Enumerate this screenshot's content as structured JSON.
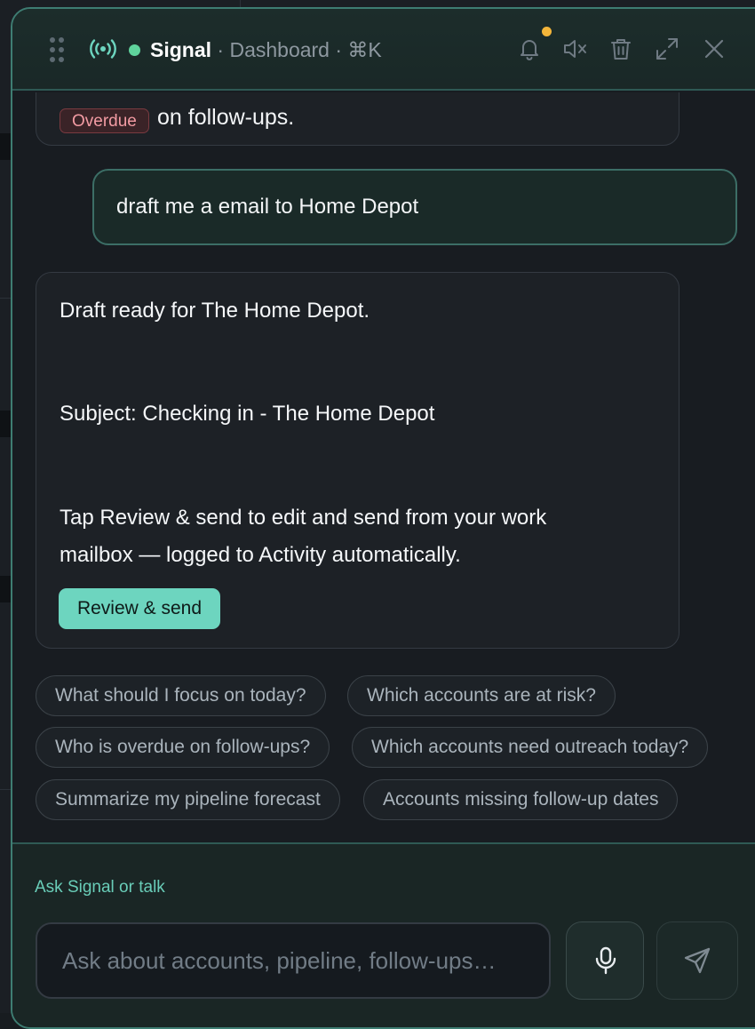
{
  "header": {
    "app_name": "Signal",
    "subtitle": " · Dashboard · ⌘K",
    "icons": [
      "drag-handle-icon",
      "broadcast-icon",
      "bell-icon",
      "mute-icon",
      "trash-icon",
      "expand-icon",
      "close-icon"
    ]
  },
  "chat": {
    "top_message": {
      "badge": "Overdue",
      "text": "on follow-ups."
    },
    "user_message": "draft me a email to Home Depot",
    "draft_message": {
      "line1": "Draft ready for The Home Depot.",
      "line2": "Subject: Checking in - The Home Depot",
      "line3": "Tap Review & send to edit and send from your work",
      "line4": "mailbox — logged to Activity automatically.",
      "button": "Review & send"
    }
  },
  "suggestions": [
    "What should I focus on today?",
    "Which accounts are at risk?",
    "Who is overdue on follow-ups?",
    "Which accounts need outreach today?",
    "Summarize my pipeline forecast",
    "Accounts missing follow-up dates"
  ],
  "composer": {
    "label": "Ask Signal or talk",
    "placeholder": "Ask about accounts, pipeline, follow-ups…"
  },
  "colors": {
    "accent": "#6dd5bf",
    "live": "#5fd39c",
    "notification": "#f3b53a",
    "overdue": "#f29ba3"
  }
}
